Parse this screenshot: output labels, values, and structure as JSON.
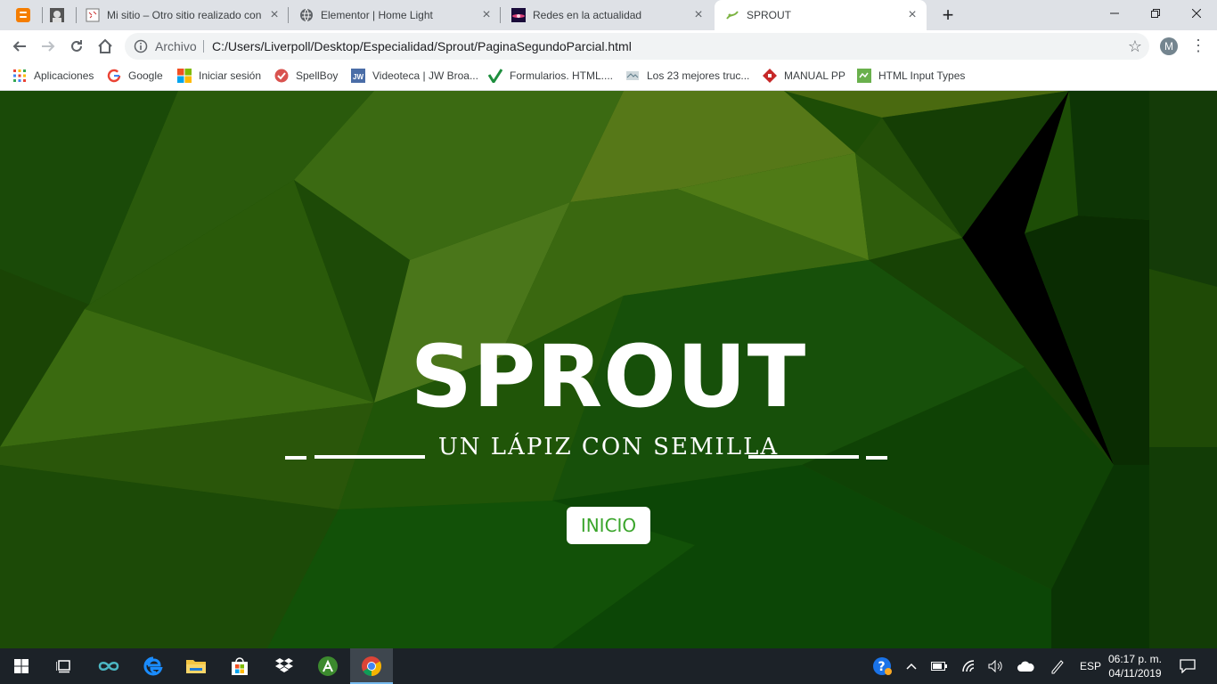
{
  "tabs": [
    {
      "icon": "blogger-icon",
      "title": ""
    },
    {
      "icon": "portrait-icon",
      "title": ""
    },
    {
      "icon": "site-icon",
      "title": "Mi sitio – Otro sitio realizado con"
    },
    {
      "icon": "globe-icon",
      "title": "Elementor | Home Light"
    },
    {
      "icon": "galaxy-icon",
      "title": "Redes en la actualidad"
    },
    {
      "icon": "sprout-icon",
      "title": "SPROUT"
    }
  ],
  "address": {
    "scheme_label": "Archivo",
    "url": "C:/Users/Liverpoll/Desktop/Especialidad/Sprout/PaginaSegundoParcial.html"
  },
  "profile": {
    "initial": "M"
  },
  "bookmarks": [
    {
      "icon": "apps-grid-icon",
      "label": "Aplicaciones"
    },
    {
      "icon": "google-icon",
      "label": "Google"
    },
    {
      "icon": "microsoft-icon",
      "label": "Iniciar sesión"
    },
    {
      "icon": "spellboy-icon",
      "label": "SpellBoy"
    },
    {
      "icon": "jw-icon",
      "label": "Videoteca | JW Broa..."
    },
    {
      "icon": "checkmark-icon",
      "label": "Formularios. HTML...."
    },
    {
      "icon": "bookmark-thumb-icon",
      "label": "Los 23 mejores truc..."
    },
    {
      "icon": "manual-icon",
      "label": "MANUAL PP"
    },
    {
      "icon": "html-input-icon",
      "label": "HTML Input Types"
    }
  ],
  "hero": {
    "title": "SPROUT",
    "tagline": "UN LÁPIZ CON SEMILLA",
    "button": "INICIO"
  },
  "taskbar": {
    "language": "ESP",
    "time": "06:17 p. m.",
    "date": "04/11/2019"
  },
  "colors": {
    "accent_green": "#3aa52b",
    "background_green": "#1f4d05",
    "taskbar": "#1c2228"
  }
}
